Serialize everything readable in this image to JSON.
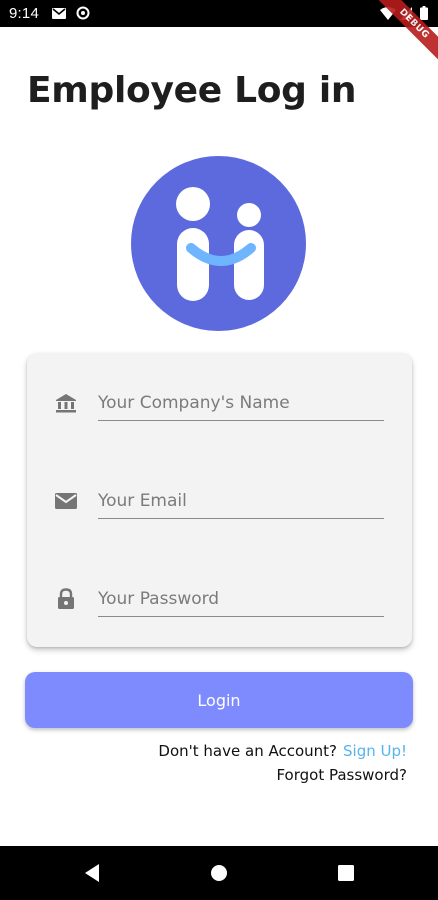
{
  "status_bar": {
    "time": "9:14",
    "icons": [
      "gmail-icon",
      "sync-icon",
      "wifi-icon",
      "signal-icon",
      "battery-icon"
    ]
  },
  "debug_banner": "DEBUG",
  "page": {
    "title": "Employee Log in"
  },
  "logo": {
    "icon": "hi-logo-icon",
    "background_color": "#5c6ade",
    "smile_color": "#6fb4ff"
  },
  "form": {
    "fields": [
      {
        "icon": "bank-icon",
        "placeholder": "Your Company's Name"
      },
      {
        "icon": "mail-icon",
        "placeholder": "Your Email"
      },
      {
        "icon": "lock-icon",
        "placeholder": "Your Password"
      }
    ]
  },
  "login_button": {
    "label": "Login",
    "color": "#7e8bff"
  },
  "signup": {
    "prompt": "Don't have an Account?",
    "link": "Sign Up!",
    "link_color": "#55b4f0"
  },
  "forgot_password": "Forgot Password?",
  "nav_bar": {
    "buttons": [
      "back-icon",
      "home-icon",
      "recents-icon"
    ]
  }
}
